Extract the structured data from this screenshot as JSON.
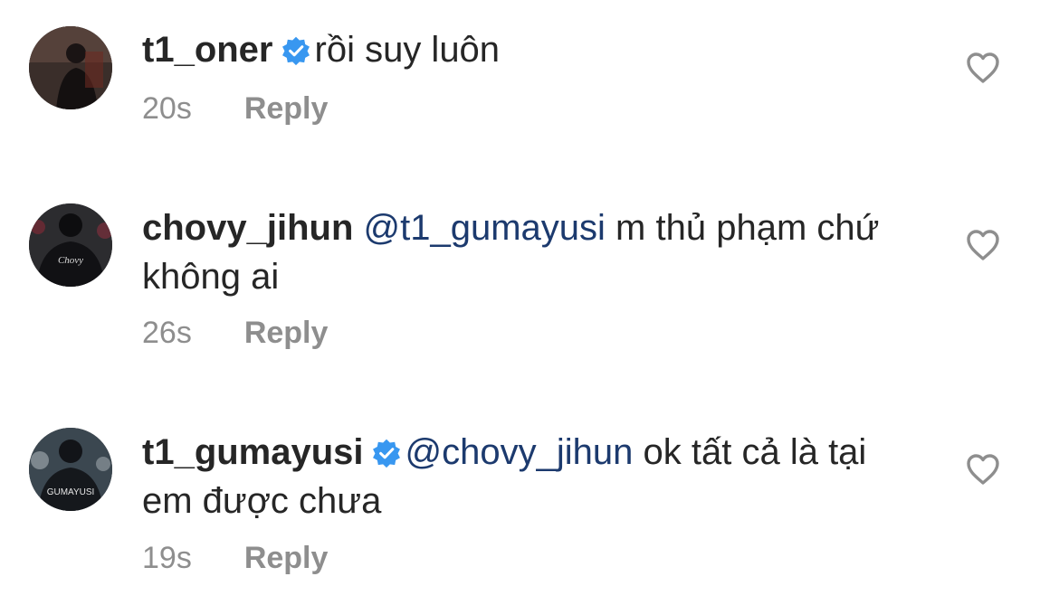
{
  "comments": [
    {
      "username": "t1_oner",
      "verified": true,
      "mention": "",
      "text": "rồi suy luôn",
      "time": "20s",
      "reply_label": "Reply"
    },
    {
      "username": "chovy_jihun",
      "verified": false,
      "mention": "@t1_gumayusi",
      "text": "m thủ phạm chứ không ai",
      "time": "26s",
      "reply_label": "Reply"
    },
    {
      "username": "t1_gumayusi",
      "verified": true,
      "mention": "@chovy_jihun",
      "text": "ok tất cả là tại em được chưa",
      "time": "19s",
      "reply_label": "Reply"
    }
  ],
  "colors": {
    "verified_badge": "#3897f0",
    "mention": "#1c3a6e",
    "meta": "#8e8e8e"
  },
  "icons": {
    "like": "heart-outline-icon",
    "verified": "verified-badge-icon"
  }
}
